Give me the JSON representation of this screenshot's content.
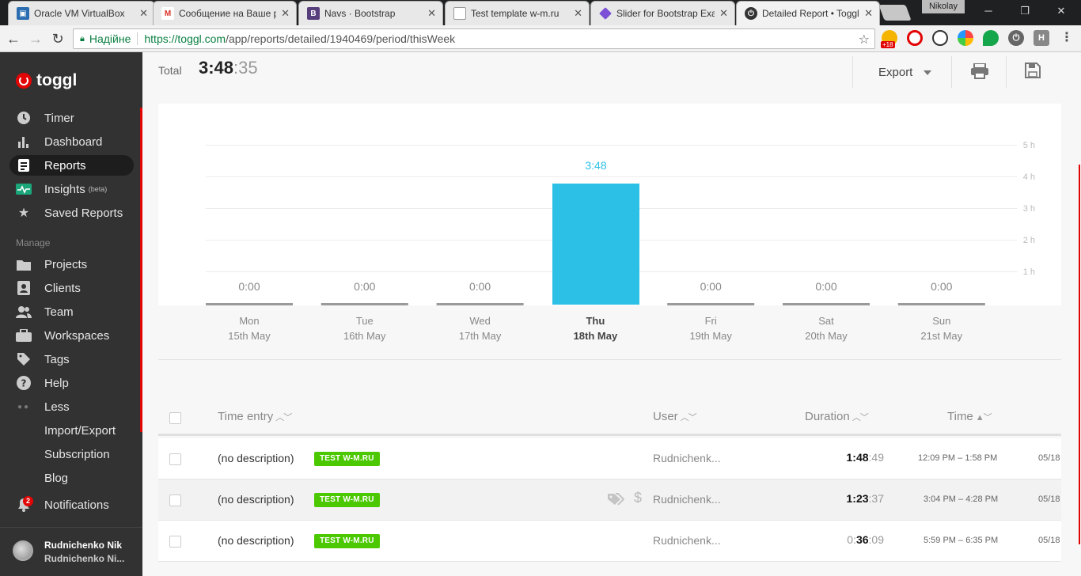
{
  "browser": {
    "tabs": [
      {
        "title": "Oracle VM VirtualBox",
        "icon": "virtualbox-icon",
        "color": "#2b6cb0"
      },
      {
        "title": "Сообщение на Ваше р",
        "icon": "gmail-icon",
        "color": "#d93025"
      },
      {
        "title": "Navs · Bootstrap",
        "icon": "bootstrap-icon",
        "color": "#563d7c"
      },
      {
        "title": "Test template w-m.ru",
        "icon": "page-icon",
        "color": "#888888"
      },
      {
        "title": "Slider for Bootstrap Exa",
        "icon": "slider-icon",
        "color": "#7b4fd6"
      },
      {
        "title": "Detailed Report • Toggl",
        "icon": "toggl-icon",
        "color": "#333333"
      }
    ],
    "profile": "Nikolay",
    "omnibox": {
      "secure_label": "Надійне",
      "url_host": "https://toggl.com",
      "url_path": "/app/reports/detailed/1940469/period/thisWeek"
    },
    "extensions_badge": "+18"
  },
  "sidebar": {
    "brand": "toggl",
    "items": [
      {
        "label": "Timer",
        "icon": "clock-icon"
      },
      {
        "label": "Dashboard",
        "icon": "bar-chart-icon"
      },
      {
        "label": "Reports",
        "icon": "report-icon"
      },
      {
        "label": "Insights",
        "icon": "insights-icon",
        "badge": "(beta)"
      },
      {
        "label": "Saved Reports",
        "icon": "star-icon"
      }
    ],
    "manage_label": "Manage",
    "manage_items": [
      {
        "label": "Projects",
        "icon": "folder-icon"
      },
      {
        "label": "Clients",
        "icon": "client-icon"
      },
      {
        "label": "Team",
        "icon": "team-icon"
      },
      {
        "label": "Workspaces",
        "icon": "briefcase-icon"
      },
      {
        "label": "Tags",
        "icon": "tag-icon"
      },
      {
        "label": "Help",
        "icon": "help-icon"
      },
      {
        "label": "Less",
        "icon": "dots-icon"
      },
      {
        "label": "Import/Export"
      },
      {
        "label": "Subscription"
      },
      {
        "label": "Blog"
      },
      {
        "label": "Notifications",
        "icon": "bell-icon",
        "count": "2"
      }
    ],
    "user": {
      "name": "Rudnichenko Nik",
      "workspace": "Rudnichenko Ni..."
    }
  },
  "report": {
    "total_label": "Total",
    "total_main": "3:48",
    "total_secs": ":35",
    "export_label": "Export"
  },
  "chart_data": {
    "type": "bar",
    "categories": [
      "Mon",
      "Tue",
      "Wed",
      "Thu",
      "Fri",
      "Sat",
      "Sun"
    ],
    "dates": [
      "15th May",
      "16th May",
      "17th May",
      "18th May",
      "19th May",
      "20th May",
      "21st May"
    ],
    "values": [
      0,
      0,
      0,
      3.8,
      0,
      0,
      0
    ],
    "value_labels": [
      "0:00",
      "0:00",
      "0:00",
      "3:48",
      "0:00",
      "0:00",
      "0:00"
    ],
    "highlight_index": 3,
    "yticks": [
      "1 h",
      "2 h",
      "3 h",
      "4 h",
      "5 h"
    ],
    "ylim": [
      0,
      5
    ],
    "colors": {
      "bar": "#2dc0e6",
      "zero_bar": "#999999",
      "label": "#2dc0e6"
    }
  },
  "table": {
    "headers": {
      "entry": "Time entry",
      "user": "User",
      "duration": "Duration",
      "time": "Time"
    },
    "rows": [
      {
        "description": "(no description)",
        "tag": "TEST W-M.RU",
        "user": "Rudnichenk...",
        "dur_lead": "",
        "dur_bold": "1:48",
        "dur_secs": ":49",
        "time": "12:09 PM – 1:58 PM",
        "date": "05/18"
      },
      {
        "description": "(no description)",
        "tag": "TEST W-M.RU",
        "user": "Rudnichenk...",
        "dur_lead": "",
        "dur_bold": "1:23",
        "dur_secs": ":37",
        "time": "3:04 PM – 4:28 PM",
        "date": "05/18"
      },
      {
        "description": "(no description)",
        "tag": "TEST W-M.RU",
        "user": "Rudnichenk...",
        "dur_lead": "0:",
        "dur_bold": "36",
        "dur_secs": ":09",
        "time": "5:59 PM – 6:35 PM",
        "date": "05/18"
      }
    ]
  }
}
